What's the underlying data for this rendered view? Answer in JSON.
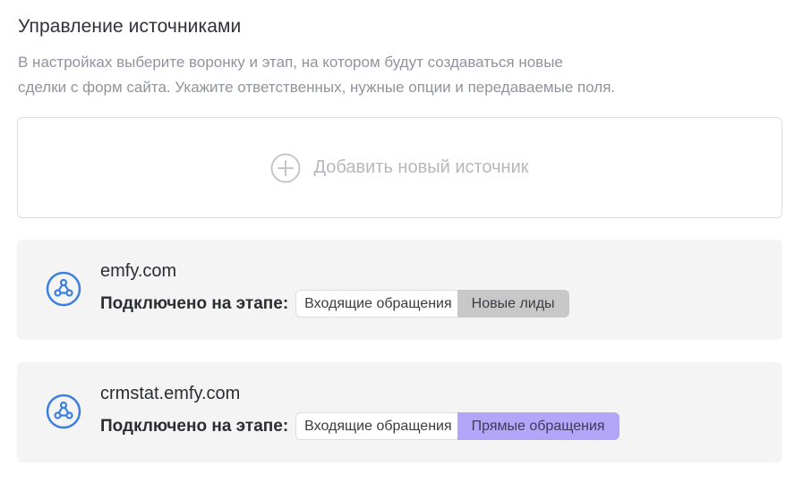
{
  "header": {
    "title": "Управление источниками",
    "description_line1": "В настройках выберите воронку и этап, на котором будут создаваться новые",
    "description_line2": "сделки с форм сайта. Укажите ответственных, нужные опции и передаваемые поля."
  },
  "add_source": {
    "label": "Добавить новый источник",
    "icon": "plus-circle-icon"
  },
  "colors": {
    "accent_blue": "#3b7fe0",
    "stage_grey": "#c8c8c9",
    "stage_purple": "#b3a5f7"
  },
  "sources": [
    {
      "name": "emfy.com",
      "icon": "webhook-icon",
      "stage_label": "Подключено на этапе:",
      "pipeline": "Входящие обращения",
      "stage": "Новые лиды"
    },
    {
      "name": "crmstat.emfy.com",
      "icon": "webhook-icon",
      "stage_label": "Подключено на этапе:",
      "pipeline": "Входящие обращения",
      "stage": "Прямые обращения"
    }
  ]
}
